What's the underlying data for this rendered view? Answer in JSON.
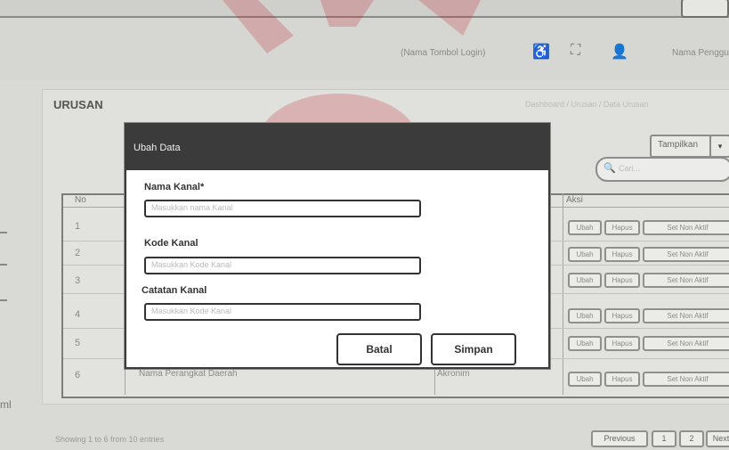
{
  "header": {
    "logout": "(Nama Tombol Login)",
    "user_name": "Nama Pengguna"
  },
  "panel": {
    "title": "URUSAN",
    "top_right_text": "Dashboard / Urusan / Data Urusan",
    "filter_value": "Tampilkan",
    "filter_arrow": "▾",
    "search_placeholder": "Cari..."
  },
  "table": {
    "headers": [
      "No",
      "",
      "",
      "Aksi"
    ],
    "rows": [
      {
        "no": "1",
        "name": "",
        "category": ""
      },
      {
        "no": "2",
        "name": "",
        "category": ""
      },
      {
        "no": "3",
        "name": "",
        "category": ""
      },
      {
        "no": "4",
        "name": "",
        "category": ""
      },
      {
        "no": "5",
        "name": "",
        "category": ""
      },
      {
        "no": "6",
        "name": "Nama Perangkat Daerah",
        "category": "Akronim"
      }
    ],
    "actions": {
      "edit": "Ubah",
      "delete": "Hapus",
      "deactivate": "Set Non Aktif"
    }
  },
  "footer": {
    "info": "Showing 1 to 6 from 10 entries",
    "prev": "Previous",
    "page1": "1",
    "page2": "2",
    "next": "Next"
  },
  "side": {
    "frag_bottom": "ml"
  },
  "modal": {
    "title": "Ubah Data",
    "field1_label": "Nama Kanal*",
    "field1_placeholder": "Masukkan nama Kanal",
    "field2_label": "Kode Kanal",
    "field2_placeholder": "Masukkan Kode Kanal",
    "field3_label": "Catatan Kanal",
    "field3_placeholder": "Masukkan Kode Kanal",
    "cancel": "Batal",
    "save": "Simpan"
  },
  "icons": {
    "accessibility": "♿",
    "fullscreen": "⛶",
    "user": "👤",
    "search": "🔍"
  }
}
